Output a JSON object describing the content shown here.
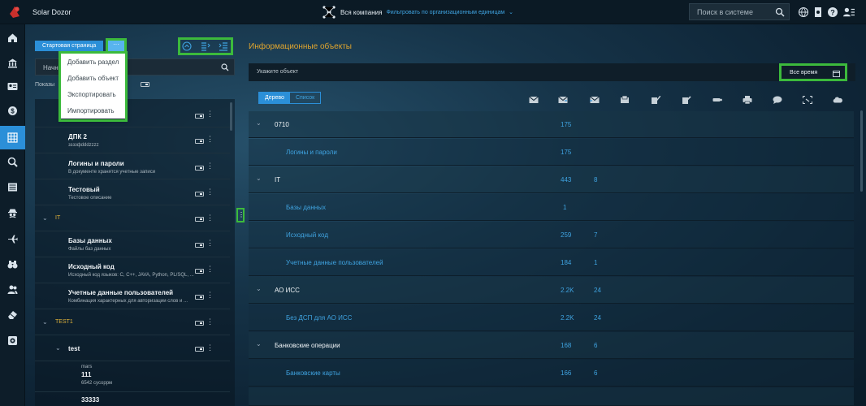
{
  "app": {
    "title": "Solar Dozor",
    "company": "Вся компания",
    "company_filter": "Фильтровать по организационным единицам"
  },
  "search": {
    "placeholder": "Поиск в системе"
  },
  "left": {
    "start_button": "Стартовая страница",
    "more_button": "···",
    "menu": [
      "Добавить раздел",
      "Добавить объект",
      "Экспортировать",
      "Импортировать"
    ],
    "search_placeholder": "Начн",
    "show_label": "Показы",
    "tree": [
      {
        "kind": "item",
        "title": "ДПК 2",
        "desc": "ззззфdddzzzz"
      },
      {
        "kind": "item",
        "title": "Логины и пароли",
        "desc": "В документе хранятся учетные записи"
      },
      {
        "kind": "item",
        "title": "Тестовый",
        "desc": "Тестовое описание"
      },
      {
        "kind": "group",
        "title": "IT"
      },
      {
        "kind": "item",
        "title": "Базы данных",
        "desc": "Файлы баз данных"
      },
      {
        "kind": "item",
        "title": "Исходный код",
        "desc": "Исходный код языков: C, C++, JAVA, Python, PL/SQL, ..."
      },
      {
        "kind": "item",
        "title": "Учетные данные пользователей",
        "desc": "Комбинация характерных для авторизации слов и ..."
      },
      {
        "kind": "group",
        "title": "TEST1"
      },
      {
        "kind": "sub",
        "title": "test"
      },
      {
        "kind": "item3",
        "title": "111",
        "pre": "mars",
        "desc": "6542 сусоррм"
      },
      {
        "kind": "item",
        "title": "33333",
        "desc": ""
      }
    ]
  },
  "right": {
    "title": "Информационные объекты",
    "object_placeholder": "Укажите объект",
    "period": "Все время",
    "tabs": {
      "tree": "Дерево",
      "list": "Список"
    },
    "toolbar_icons": [
      "mail-icon",
      "mail-out-icon",
      "mail-in-icon",
      "mail-box-icon",
      "doc-check-icon",
      "doc-edit-icon",
      "usb-icon",
      "printer-icon",
      "chat-icon",
      "screen-icon",
      "cloud-icon"
    ],
    "rows": [
      {
        "level": 0,
        "label": "0710",
        "v1": "175",
        "v2": ""
      },
      {
        "level": 1,
        "label": "Логины и пароли",
        "v1": "175",
        "v2": ""
      },
      {
        "level": 0,
        "label": "IT",
        "v1": "443",
        "v2": "8"
      },
      {
        "level": 1,
        "label": "Базы данных",
        "v1": "1",
        "v2": ""
      },
      {
        "level": 1,
        "label": "Исходный код",
        "v1": "259",
        "v2": "7"
      },
      {
        "level": 1,
        "label": "Учетные данные пользователей",
        "v1": "184",
        "v2": "1"
      },
      {
        "level": 0,
        "label": "АО ИСС",
        "v1": "2.2K",
        "v2": "24"
      },
      {
        "level": 1,
        "label": "Без ДСП для АО ИСС",
        "v1": "2.2K",
        "v2": "24"
      },
      {
        "level": 0,
        "label": "Банковские операции",
        "v1": "168",
        "v2": "6"
      },
      {
        "level": 1,
        "label": "Банковские карты",
        "v1": "166",
        "v2": "6"
      }
    ]
  },
  "nav": [
    "home-icon",
    "bank-icon",
    "id-card-icon",
    "dollar-icon",
    "grid-icon",
    "search-icon",
    "list-icon",
    "spy-icon",
    "plane-icon",
    "binoculars-icon",
    "users-icon",
    "eraser-icon",
    "gear-icon"
  ],
  "colors": {
    "accent": "#2b8fd8",
    "highlight": "#3cba3c",
    "title": "#e0a52e"
  }
}
